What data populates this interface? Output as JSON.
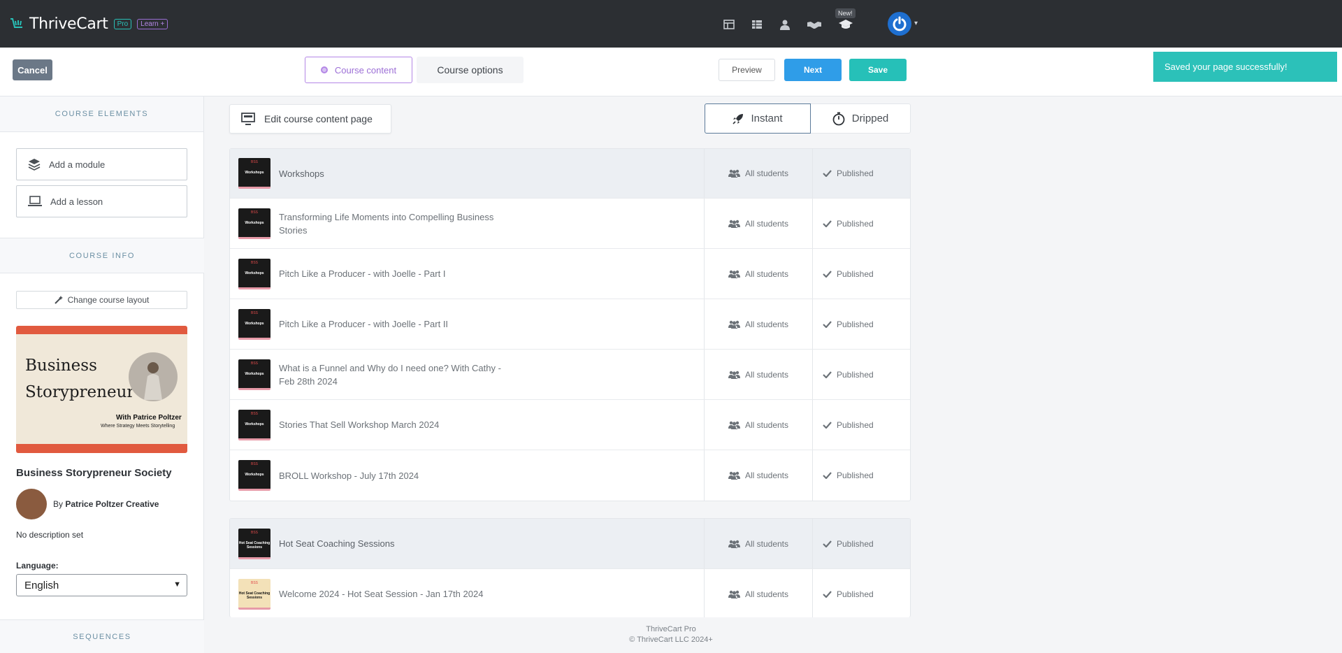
{
  "app": {
    "brand_name": "ThriveCart",
    "pro_badge": "Pro",
    "learn_badge": "Learn +",
    "new_badge": "New!",
    "nav_icons": [
      "layout-icon",
      "table-icon",
      "user-icon",
      "handshake-icon",
      "graduation-cap-icon"
    ]
  },
  "toolbar": {
    "cancel_label": "Cancel",
    "tab_content_label": "Course content",
    "tab_options_label": "Course options",
    "preview_label": "Preview",
    "next_label": "Next",
    "save_label": "Save",
    "toast": "Saved your page successfully!"
  },
  "sidebar": {
    "course_elements_title": "COURSE ELEMENTS",
    "add_module_label": "Add a module",
    "add_lesson_label": "Add a lesson",
    "course_info_title": "COURSE INFO",
    "change_layout_label": "Change course layout",
    "cover": {
      "title_line1": "Business",
      "title_line2": "Storypreneur",
      "with_text": "With Patrice Poltzer",
      "tagline": "Where Strategy Meets Storytelling"
    },
    "course_name": "Business Storypreneur Society",
    "author_prefix": "By",
    "author_name": "Patrice Poltzer Creative",
    "description": "No description set",
    "language_label": "Language:",
    "language_value": "English",
    "sequences_title": "SEQUENCES"
  },
  "main": {
    "edit_page_label": "Edit course content page",
    "instant_label": "Instant",
    "dripped_label": "Dripped",
    "modules": [
      {
        "rows": [
          {
            "title": "Workshops",
            "thumb_tag": "BSS",
            "thumb_text": "Workshops",
            "access": "All students",
            "status": "Published"
          },
          {
            "title": "Transforming Life Moments into Compelling Business Stories",
            "thumb_tag": "BSS",
            "thumb_text": "Workshops",
            "access": "All students",
            "status": "Published"
          },
          {
            "title": "Pitch Like a Producer - with Joelle - Part I",
            "thumb_tag": "BSS",
            "thumb_text": "Workshops",
            "access": "All students",
            "status": "Published"
          },
          {
            "title": "Pitch Like a Producer - with Joelle - Part II",
            "thumb_tag": "BSS",
            "thumb_text": "Workshops",
            "access": "All students",
            "status": "Published"
          },
          {
            "title": "What is a Funnel and Why do I need one? With Cathy - Feb 28th 2024",
            "thumb_tag": "BSS",
            "thumb_text": "Workshops",
            "access": "All students",
            "status": "Published"
          },
          {
            "title": "Stories That Sell Workshop March 2024",
            "thumb_tag": "BSS",
            "thumb_text": "Workshops",
            "access": "All students",
            "status": "Published"
          },
          {
            "title": "BROLL Workshop - July 17th 2024",
            "thumb_tag": "BSS",
            "thumb_text": "Workshops",
            "access": "All students",
            "status": "Published"
          }
        ]
      },
      {
        "rows": [
          {
            "title": "Hot Seat Coaching Sessions",
            "thumb_tag": "BSS",
            "thumb_text": "Hot Seat Coaching Sessions",
            "access": "All students",
            "status": "Published"
          },
          {
            "title": "Welcome 2024 - Hot Seat Session - Jan 17th 2024",
            "thumb_tag": "BSS",
            "thumb_text": "Hot Seat Coaching Sessions",
            "access": "All students",
            "status": "Published"
          }
        ]
      }
    ]
  },
  "footer": {
    "line1": "ThriveCart Pro",
    "line2": "© ThriveCart LLC 2024+"
  }
}
